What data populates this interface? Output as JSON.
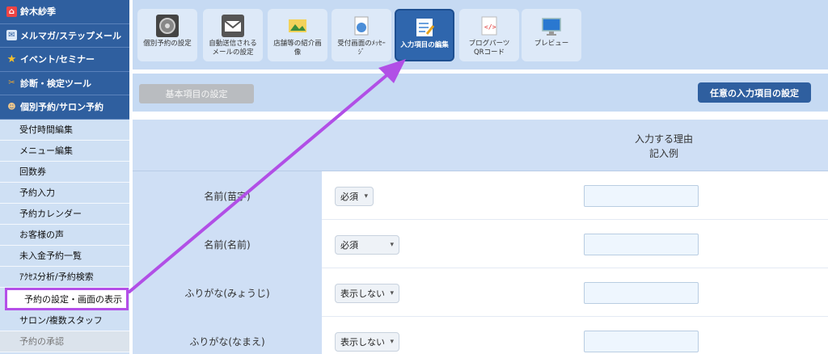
{
  "sidebar": {
    "main_items": [
      {
        "label": "鈴木紗季",
        "icon": "home-icon"
      },
      {
        "label": "メルマガ/ステップメール",
        "icon": "mail-icon"
      },
      {
        "label": "イベント/セミナー",
        "icon": "star-icon"
      },
      {
        "label": "診断・検定ツール",
        "icon": "tools-icon"
      },
      {
        "label": "個別予約/サロン予約",
        "icon": "person-icon"
      }
    ],
    "sub_items": [
      {
        "label": "受付時間編集"
      },
      {
        "label": "メニュー編集"
      },
      {
        "label": "回数券"
      },
      {
        "label": "予約入力"
      },
      {
        "label": "予約カレンダー"
      },
      {
        "label": "お客様の声"
      },
      {
        "label": "未入金予約一覧"
      },
      {
        "label": "ｱｸｾｽ分析/予約検索"
      },
      {
        "label": "予約の設定・画面の表示"
      },
      {
        "label": "サロン/複数スタッフ"
      },
      {
        "label": "予約の承認"
      }
    ]
  },
  "toolbar": {
    "items": [
      {
        "label": "個別予約の設定",
        "icon": "settings-icon"
      },
      {
        "label": "自動送信される\nメールの設定",
        "icon": "mail-icon"
      },
      {
        "label": "店舗等の紹介画\n像",
        "icon": "image-icon"
      },
      {
        "label": "受付画面のﾒｯｾｰ\nｼﾞ",
        "icon": "document-icon"
      },
      {
        "label": "入力項目の編集",
        "icon": "edit-form-icon"
      },
      {
        "label": "ブログパーツ\nQRコード",
        "icon": "code-icon"
      },
      {
        "label": "プレビュー",
        "icon": "monitor-icon"
      }
    ]
  },
  "subbar": {
    "basic_label": "基本項目の設定",
    "optional_label": "任意の入力項目の設定"
  },
  "table": {
    "header_reason": "入力する理由\n記入例",
    "rows": [
      {
        "label": "名前(苗字)",
        "select": "必須"
      },
      {
        "label": "名前(名前)",
        "select": "必須"
      },
      {
        "label": "ふりがな(みょうじ)",
        "select": "表示しない"
      },
      {
        "label": "ふりがな(なまえ)",
        "select": "表示しない"
      }
    ]
  },
  "colors": {
    "sidebar_main": "#2f5f9f",
    "sidebar_sub": "#cfe0f4",
    "toolbar_bg": "#c6daf3",
    "active_tool": "#2f66ad",
    "highlight": "#b44fe8"
  }
}
